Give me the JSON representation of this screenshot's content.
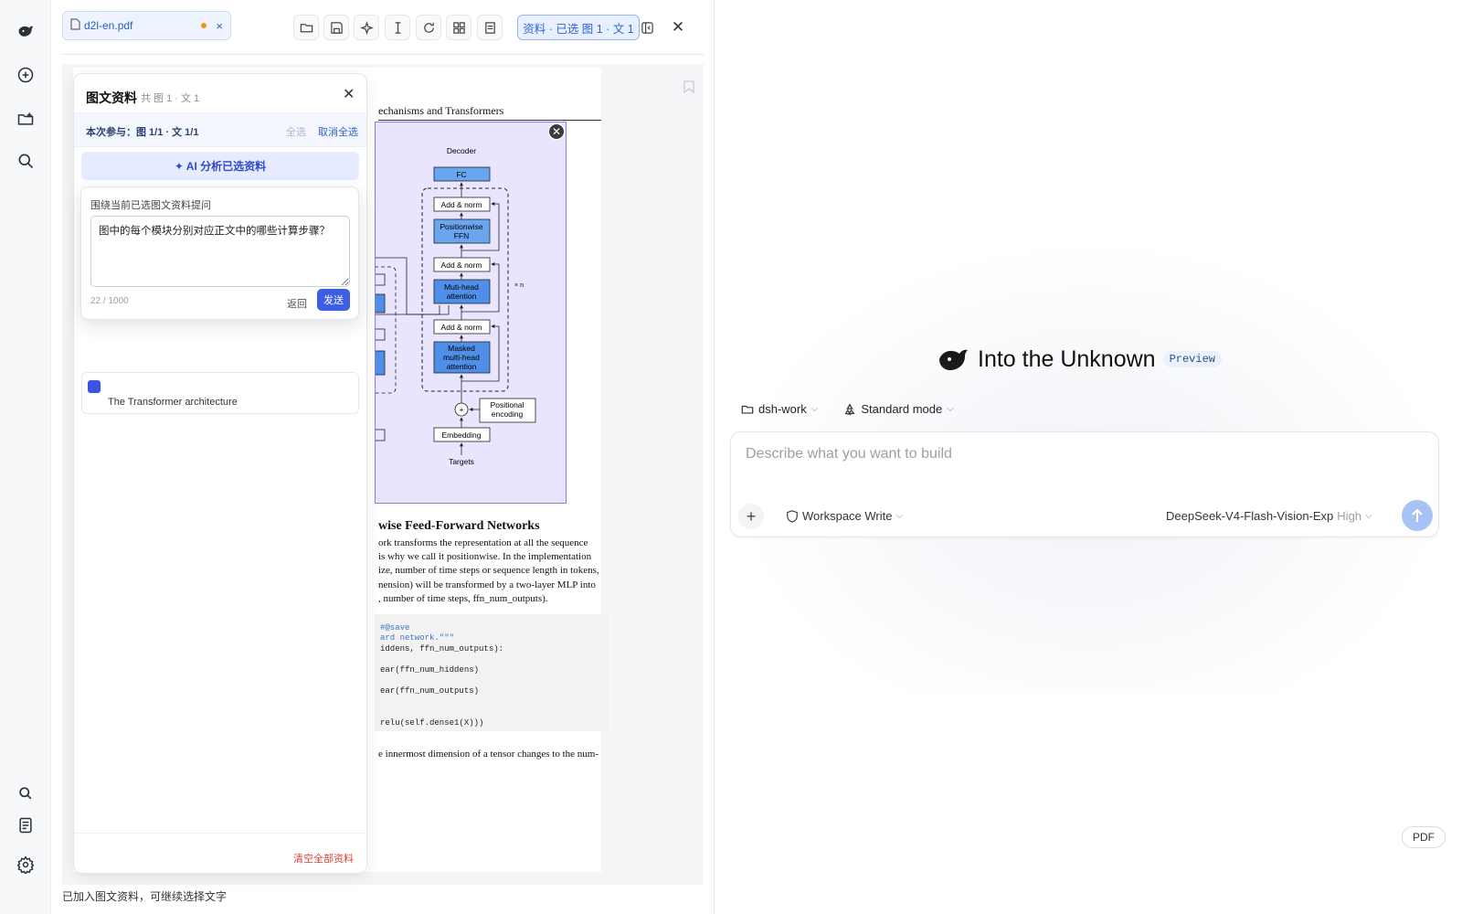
{
  "rail": {
    "icons": [
      "logo-whale-icon",
      "new-chat-icon",
      "new-folder-icon",
      "search-icon",
      "search-small-icon",
      "document-icon",
      "settings-icon"
    ]
  },
  "toolbar": {
    "file_tab": "d2l-en.pdf",
    "file_close": "×",
    "selection_chip": "资料 · 已选 图 1 · 文 1",
    "close": "✕"
  },
  "pdf": {
    "running_head": "echanisms and Transformers",
    "figure": {
      "decoder": "Decoder",
      "fc": "FC",
      "add_norm": "Add & norm",
      "ffn_1": "Positionwise",
      "ffn_2": "FFN",
      "mha_1": "Muti-head",
      "mha_2": "attention",
      "masked_1": "Masked",
      "masked_2": "multi-head",
      "masked_3": "attention",
      "pos_1": "Positional",
      "pos_2": "encoding",
      "embedding": "Embedding",
      "targets": "Targets",
      "xn": "× n",
      "plus": "+"
    },
    "section_title": "wise Feed-Forward Networks",
    "para_lines": [
      "ork transforms the representation at all the sequence",
      "is why we call it positionwise. In the implementation",
      "ize, number of time steps or sequence length in tokens,",
      "nension) will be transformed by a two-layer MLP into",
      ", number of time steps, ffn_num_outputs)."
    ],
    "code_lines": [
      "         #@save",
      "ard network.\"\"\"",
      "iddens, ffn_num_outputs):",
      "",
      "ear(ffn_num_hiddens)",
      "",
      "ear(ffn_num_outputs)",
      "",
      "",
      "relu(self.dense1(X)))"
    ],
    "para2": "e innermost dimension of a tensor changes to the num-"
  },
  "status_bar": "已加入图文资料，可继续选择文字",
  "materials": {
    "title": "图文资料",
    "subtitle": "共 图 1 · 文 1",
    "participation": "本次参与：图 1/1 · 文 1/1",
    "select_all": "全选",
    "deselect_all": "取消全选",
    "ai_button": "✦ AI 分析已选资料",
    "card_caption": "The Transformer architecture",
    "clear_all": "清空全部资料"
  },
  "question_popup": {
    "label": "围绕当前已选图文资料提问",
    "question": "图中的每个模块分别对应正文中的哪些计算步骤？",
    "counter": "22 / 1000",
    "back": "返回",
    "send": "发送"
  },
  "chat": {
    "brand": "Into the Unknown",
    "badge": "Preview",
    "workspace": "dsh-work",
    "mode": "Standard mode",
    "placeholder": "Describe what you want to build",
    "permission": "Workspace Write",
    "model": "DeepSeek-V4-Flash-Vision-Exp",
    "level": "High",
    "pdf_button": "PDF"
  },
  "colors": {
    "accent": "#3f5ee8",
    "figure_bg": "#e9e5ff",
    "block_blue": "#6aa6f0",
    "danger": "#d9433c"
  }
}
